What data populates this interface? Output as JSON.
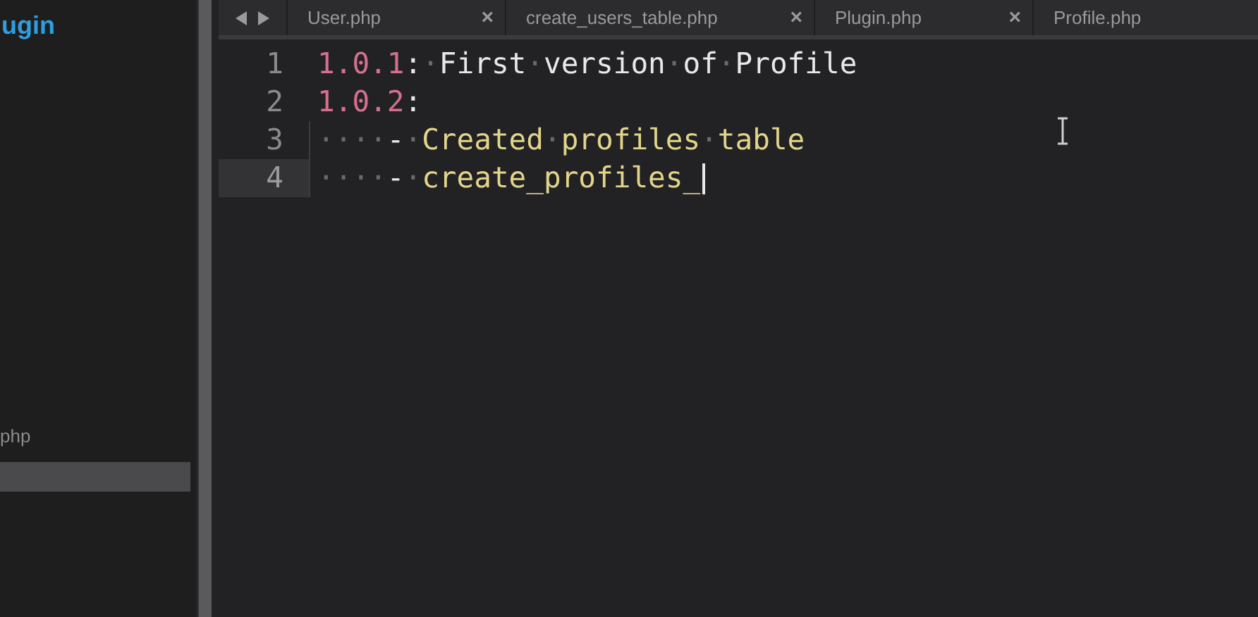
{
  "sidebar": {
    "items": [
      {
        "text": "ugin",
        "kind": "heading",
        "selected": false
      },
      {
        "text": "php",
        "kind": "file",
        "selected": false
      },
      {
        "kind": "file",
        "selected": true
      }
    ]
  },
  "tabs": [
    {
      "label": "User.php",
      "close": "×"
    },
    {
      "label": "create_users_table.php",
      "close": "×"
    },
    {
      "label": "Plugin.php",
      "close": "×"
    },
    {
      "label": "Profile.php"
    }
  ],
  "editor": {
    "lines": [
      {
        "number": "1",
        "current": false,
        "tokens": [
          {
            "kind": "version",
            "text": "1.0.1"
          },
          {
            "kind": "plain",
            "text": ":·First·version·of·Profile"
          }
        ]
      },
      {
        "number": "2",
        "current": false,
        "tokens": [
          {
            "kind": "version",
            "text": "1.0.2"
          },
          {
            "kind": "plain",
            "text": ":"
          }
        ]
      },
      {
        "number": "3",
        "current": false,
        "tokens": [
          {
            "kind": "plain",
            "text": "····-·"
          },
          {
            "kind": "string",
            "text": "Created·profiles·table"
          }
        ]
      },
      {
        "number": "4",
        "current": true,
        "tokens": [
          {
            "kind": "plain",
            "text": "····-·"
          },
          {
            "kind": "string",
            "text": "create_profiles_"
          }
        ]
      }
    ]
  }
}
